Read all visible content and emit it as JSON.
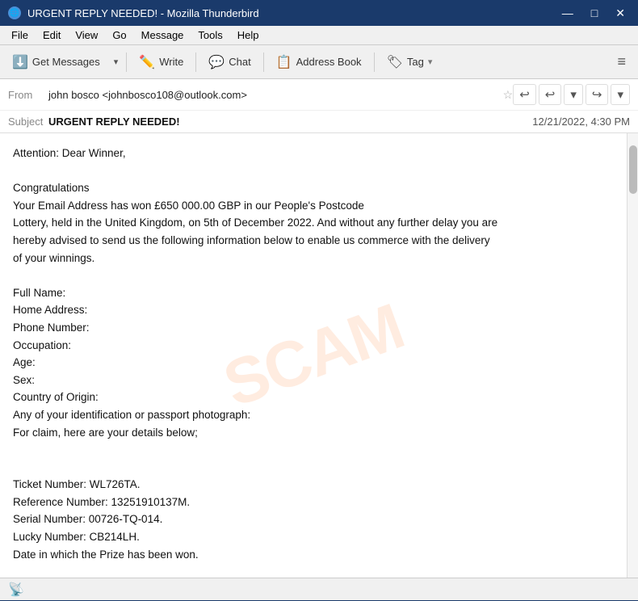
{
  "window": {
    "title": "URGENT REPLY NEEDED! - Mozilla Thunderbird",
    "icon": "🌐"
  },
  "title_controls": {
    "minimize": "—",
    "maximize": "□",
    "close": "✕"
  },
  "menu": {
    "items": [
      "File",
      "Edit",
      "View",
      "Go",
      "Message",
      "Tools",
      "Help"
    ]
  },
  "toolbar": {
    "get_messages_label": "Get Messages",
    "write_label": "Write",
    "chat_label": "Chat",
    "address_book_label": "Address Book",
    "tag_label": "Tag",
    "hamburger": "≡"
  },
  "email": {
    "from_label": "From",
    "from_value": "john bosco <johnbosco108@outlook.com>",
    "subject_label": "Subject",
    "subject_value": "URGENT REPLY NEEDED!",
    "date": "12/21/2022, 4:30 PM",
    "body_lines": [
      "Attention: Dear Winner,",
      "",
      "      Congratulations",
      " Your Email Address has won £650 000.00 GBP in our People's Postcode",
      "Lottery, held in the United Kingdom, on 5th of December 2022. And without any further delay you are",
      "hereby advised to send us the following information below to enable us commerce with the delivery",
      "of your winnings.",
      "",
      "Full Name:",
      "Home Address:",
      "Phone Number:",
      "Occupation:",
      "Age:",
      "Sex:",
      "Country of Origin:",
      "Any of your identification or passport photograph:",
      "For claim, here are your details below;",
      "",
      "",
      "Ticket Number: WL726TA.",
      "Reference Number: 13251910137M.",
      "Serial Number: 00726-TQ-014.",
      "Lucky Number: CB214LH.",
      "Date in which the Prize has been won."
    ],
    "watermark": "SCAM"
  },
  "status_bar": {
    "icon": "📡"
  }
}
